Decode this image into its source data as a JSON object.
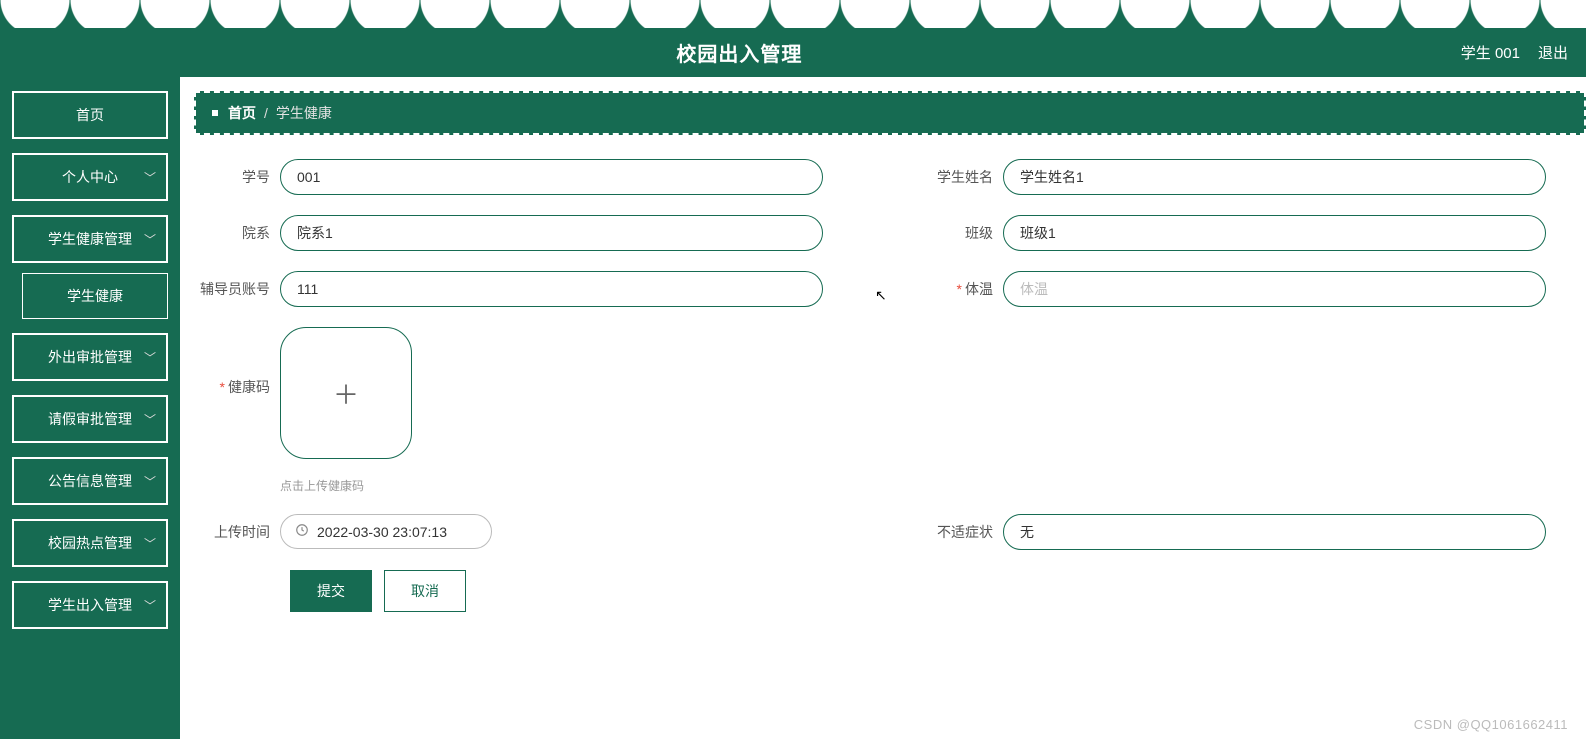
{
  "header": {
    "title": "校园出入管理",
    "user": "学生 001",
    "logout": "退出"
  },
  "sidebar": {
    "items": [
      {
        "label": "首页",
        "expandable": false
      },
      {
        "label": "个人中心",
        "expandable": true
      },
      {
        "label": "学生健康管理",
        "expandable": true,
        "children": [
          {
            "label": "学生健康"
          }
        ]
      },
      {
        "label": "外出审批管理",
        "expandable": true
      },
      {
        "label": "请假审批管理",
        "expandable": true
      },
      {
        "label": "公告信息管理",
        "expandable": true
      },
      {
        "label": "校园热点管理",
        "expandable": true
      },
      {
        "label": "学生出入管理",
        "expandable": true
      }
    ]
  },
  "breadcrumb": {
    "home": "首页",
    "sep": "/",
    "current": "学生健康"
  },
  "form": {
    "fields": {
      "student_id": {
        "label": "学号",
        "value": "001",
        "required": false
      },
      "student_name": {
        "label": "学生姓名",
        "value": "学生姓名1",
        "required": false
      },
      "faculty": {
        "label": "院系",
        "value": "院系1",
        "required": false
      },
      "class": {
        "label": "班级",
        "value": "班级1",
        "required": false
      },
      "counselor": {
        "label": "辅导员账号",
        "value": "111",
        "required": false
      },
      "temperature": {
        "label": "体温",
        "value": "",
        "placeholder": "体温",
        "required": true
      },
      "health_code": {
        "label": "健康码",
        "hint": "点击上传健康码",
        "required": true
      },
      "upload_time": {
        "label": "上传时间",
        "value": "2022-03-30 23:07:13",
        "required": false
      },
      "symptoms": {
        "label": "不适症状",
        "value": "无",
        "required": false
      }
    },
    "buttons": {
      "submit": "提交",
      "cancel": "取消"
    }
  },
  "watermark": "CSDN @QQ1061662411"
}
